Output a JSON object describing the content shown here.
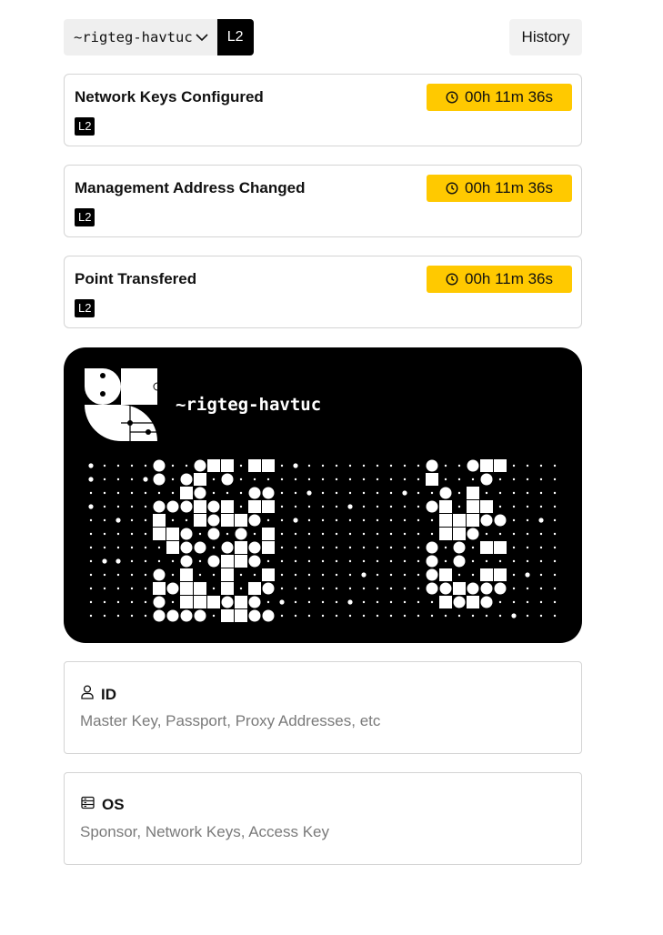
{
  "header": {
    "point_name": "~rigteg-havtuc",
    "layer": "L2",
    "history_label": "History",
    "icons": {
      "dropdown": "chevron-down-icon"
    }
  },
  "events": [
    {
      "title": "Network Keys Configured",
      "layer": "L2",
      "timer": "00h 11m 36s"
    },
    {
      "title": "Management Address Changed",
      "layer": "L2",
      "timer": "00h 11m 36s"
    },
    {
      "title": "Point Transfered",
      "layer": "L2",
      "timer": "00h 11m 36s"
    }
  ],
  "card": {
    "point_name": "~rigteg-havtuc"
  },
  "sections": {
    "id": {
      "title": "ID",
      "description": "Master Key, Passport, Proxy Addresses, etc",
      "icon": "user-icon"
    },
    "os": {
      "title": "OS",
      "description": "Sponsor, Network Keys, Access Key",
      "icon": "server-icon"
    }
  },
  "colors": {
    "timer_bg": "#ffc900",
    "card_bg": "#000000",
    "tag_bg": "#000000"
  }
}
